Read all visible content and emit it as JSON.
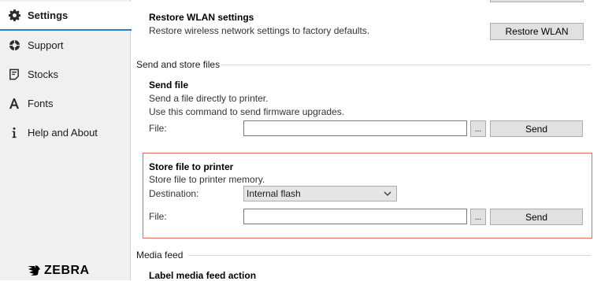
{
  "sidebar": {
    "items": [
      {
        "label": "Settings",
        "icon": "gear-icon",
        "active": true
      },
      {
        "label": "Support",
        "icon": "lifebuoy-icon",
        "active": false
      },
      {
        "label": "Stocks",
        "icon": "stock-label-icon",
        "active": false
      },
      {
        "label": "Fonts",
        "icon": "font-a-icon",
        "active": false
      },
      {
        "label": "Help and About",
        "icon": "info-icon",
        "active": false
      }
    ],
    "logo_text": "ZEBRA"
  },
  "restore_wlan": {
    "title": "Restore WLAN settings",
    "description": "Restore wireless network settings to factory defaults.",
    "button_label": "Restore WLAN"
  },
  "send_store_section": {
    "heading": "Send and store files",
    "send_file": {
      "title": "Send file",
      "description_line1": "Send a file directly to printer.",
      "description_line2": "Use this command to send firmware upgrades.",
      "file_label": "File:",
      "file_value": "",
      "browse_label": "...",
      "send_label": "Send"
    },
    "store_file": {
      "title": "Store file to printer",
      "description": "Store file to printer memory.",
      "destination_label": "Destination:",
      "destination_value": "Internal flash",
      "file_label": "File:",
      "file_value": "",
      "browse_label": "...",
      "send_label": "Send"
    }
  },
  "media_feed_section": {
    "heading": "Media feed",
    "label_feed_title": "Label media feed action"
  },
  "colors": {
    "highlight_border": "#e8675f",
    "active_nav_underline": "#2b7cd3",
    "sidebar_bg": "#f0f0f0"
  }
}
